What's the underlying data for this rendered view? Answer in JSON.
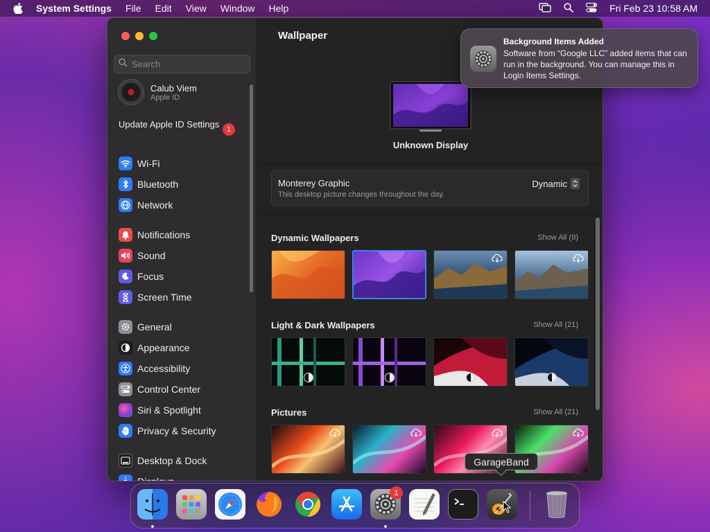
{
  "menubar": {
    "app_name": "System Settings",
    "menus": [
      "File",
      "Edit",
      "View",
      "Window",
      "Help"
    ],
    "clock": "Fri Feb 23  10:58 AM"
  },
  "sidebar": {
    "search_placeholder": "Search",
    "account": {
      "name": "Calub Viem",
      "subtitle": "Apple ID"
    },
    "update": {
      "label": "Update Apple ID Settings",
      "badge": "1"
    },
    "groups": [
      [
        {
          "label": "Wi-Fi",
          "icon": "wifi-icon",
          "color": "#2f7cf6"
        },
        {
          "label": "Bluetooth",
          "icon": "bluetooth-icon",
          "color": "#2f7cf6"
        },
        {
          "label": "Network",
          "icon": "globe-icon",
          "color": "#2f7cf6"
        }
      ],
      [
        {
          "label": "Notifications",
          "icon": "bell-icon",
          "color": "#ea4a4a"
        },
        {
          "label": "Sound",
          "icon": "speaker-icon",
          "color": "#e8435c"
        },
        {
          "label": "Focus",
          "icon": "moon-icon",
          "color": "#5e5ce6"
        },
        {
          "label": "Screen Time",
          "icon": "hourglass-icon",
          "color": "#5e5ce6"
        }
      ],
      [
        {
          "label": "General",
          "icon": "gear-icon",
          "color": "#8e8e93"
        },
        {
          "label": "Appearance",
          "icon": "appearance-icon",
          "color": "#1c1c1e"
        },
        {
          "label": "Accessibility",
          "icon": "accessibility-icon",
          "color": "#2f7cf6"
        },
        {
          "label": "Control Center",
          "icon": "toggles-icon",
          "color": "#8e8e93"
        },
        {
          "label": "Siri & Spotlight",
          "icon": "siri-icon",
          "color": "#b04fd6"
        },
        {
          "label": "Privacy & Security",
          "icon": "hand-icon",
          "color": "#2f7cf6"
        }
      ],
      [
        {
          "label": "Desktop & Dock",
          "icon": "dock-icon",
          "color": "#1c1c1e"
        },
        {
          "label": "Displays",
          "icon": "sun-icon",
          "color": "#2f7cf6"
        }
      ]
    ]
  },
  "main": {
    "title": "Wallpaper",
    "display_name": "Unknown Display",
    "current": {
      "name": "Monterey Graphic",
      "description": "This desktop picture changes throughout the day.",
      "mode": "Dynamic"
    },
    "sections": [
      {
        "title": "Dynamic Wallpapers",
        "show_all": "Show All (9)"
      },
      {
        "title": "Light & Dark Wallpapers",
        "show_all": "Show All (21)"
      },
      {
        "title": "Pictures",
        "show_all": "Show All (21)"
      }
    ]
  },
  "notification": {
    "title": "Background Items Added",
    "body": "Software from “Google LLC” added items that can run in the background. You can manage this in Login Items Settings."
  },
  "dock": {
    "tooltip": "GarageBand",
    "settings_badge": "1",
    "apps": [
      "finder-icon",
      "launchpad-icon",
      "safari-icon",
      "firefox-icon",
      "chrome-icon",
      "app-store-icon",
      "system-settings-icon",
      "textedit-icon",
      "terminal-icon",
      "garageband-icon",
      "trash-icon"
    ]
  }
}
